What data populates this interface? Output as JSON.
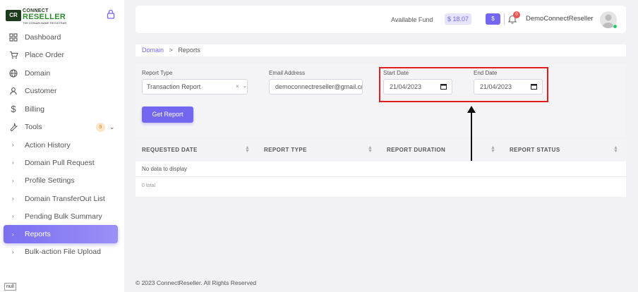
{
  "brand": {
    "line1": "CONNECT",
    "line2": "RESELLER",
    "tagline": "THE DOMAIN NAME REGISTRAR",
    "mark": "CR"
  },
  "sidebar": {
    "items": [
      {
        "label": "Dashboard",
        "icon": "grid-icon"
      },
      {
        "label": "Place Order",
        "icon": "cart-icon"
      },
      {
        "label": "Domain",
        "icon": "globe-icon"
      },
      {
        "label": "Customer",
        "icon": "user-icon"
      },
      {
        "label": "Billing",
        "icon": "dollar-icon"
      },
      {
        "label": "Tools",
        "icon": "wrench-icon",
        "badge": "9"
      }
    ],
    "subitems": [
      {
        "label": "Action History"
      },
      {
        "label": "Domain Pull Request"
      },
      {
        "label": "Profile Settings"
      },
      {
        "label": "Domain TransferOut List"
      },
      {
        "label": "Pending Bulk Summary"
      },
      {
        "label": "Reports",
        "active": true
      },
      {
        "label": "Bulk-action File Upload"
      }
    ],
    "null_tag": "null"
  },
  "header": {
    "fund_label": "Available Fund",
    "fund_value": "$ 18.07",
    "s_button": "$",
    "notification_count": "0",
    "user_name": "DemoConnectReseller"
  },
  "breadcrumb": {
    "link": "Domain",
    "separator": ">",
    "current": "Reports"
  },
  "filters": {
    "report_type_label": "Report Type",
    "report_type_value": "Transaction Report",
    "email_label": "Email Address",
    "email_value": "democonnectreseller@gmail.com",
    "start_label": "Start Date",
    "start_value": "21/04/2023",
    "end_label": "End Date",
    "end_value": "21/04/2023",
    "get_report_label": "Get Report"
  },
  "table": {
    "headers": [
      "REQUESTED DATE",
      "REPORT TYPE",
      "REPORT DURATION",
      "REPORT STATUS"
    ],
    "no_data": "No data to display",
    "total": "0 total"
  },
  "footer": {
    "copyright": "© 2023 ConnectReseller. All Rights Reserved"
  },
  "colors": {
    "primary": "#7367f0",
    "annotation": "#e02020",
    "badge": "#ea5455"
  }
}
